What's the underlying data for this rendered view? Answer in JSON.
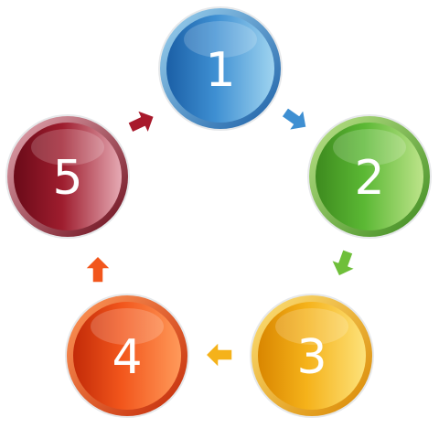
{
  "diagram": {
    "steps": [
      {
        "label": "1",
        "color_dark": "#1b5fa6",
        "color_mid": "#3e8fd2",
        "color_light": "#9fd4f0"
      },
      {
        "label": "2",
        "color_dark": "#3d8a1e",
        "color_mid": "#5bb834",
        "color_light": "#bde48a"
      },
      {
        "label": "3",
        "color_dark": "#d98600",
        "color_mid": "#f5b21a",
        "color_light": "#fde27a"
      },
      {
        "label": "4",
        "color_dark": "#c22a08",
        "color_mid": "#f2561c",
        "color_light": "#ff9a5a"
      },
      {
        "label": "5",
        "color_dark": "#6a0a18",
        "color_mid": "#9e1d2e",
        "color_light": "#e6aab4"
      }
    ],
    "arrows": [
      {
        "from": "1",
        "to": "2",
        "color": "#3e8fd2"
      },
      {
        "from": "2",
        "to": "3",
        "color": "#6fbf3a"
      },
      {
        "from": "3",
        "to": "4",
        "color": "#f5b21a"
      },
      {
        "from": "4",
        "to": "5",
        "color": "#f2561c"
      },
      {
        "from": "5",
        "to": "1",
        "color": "#a8192b"
      }
    ]
  }
}
